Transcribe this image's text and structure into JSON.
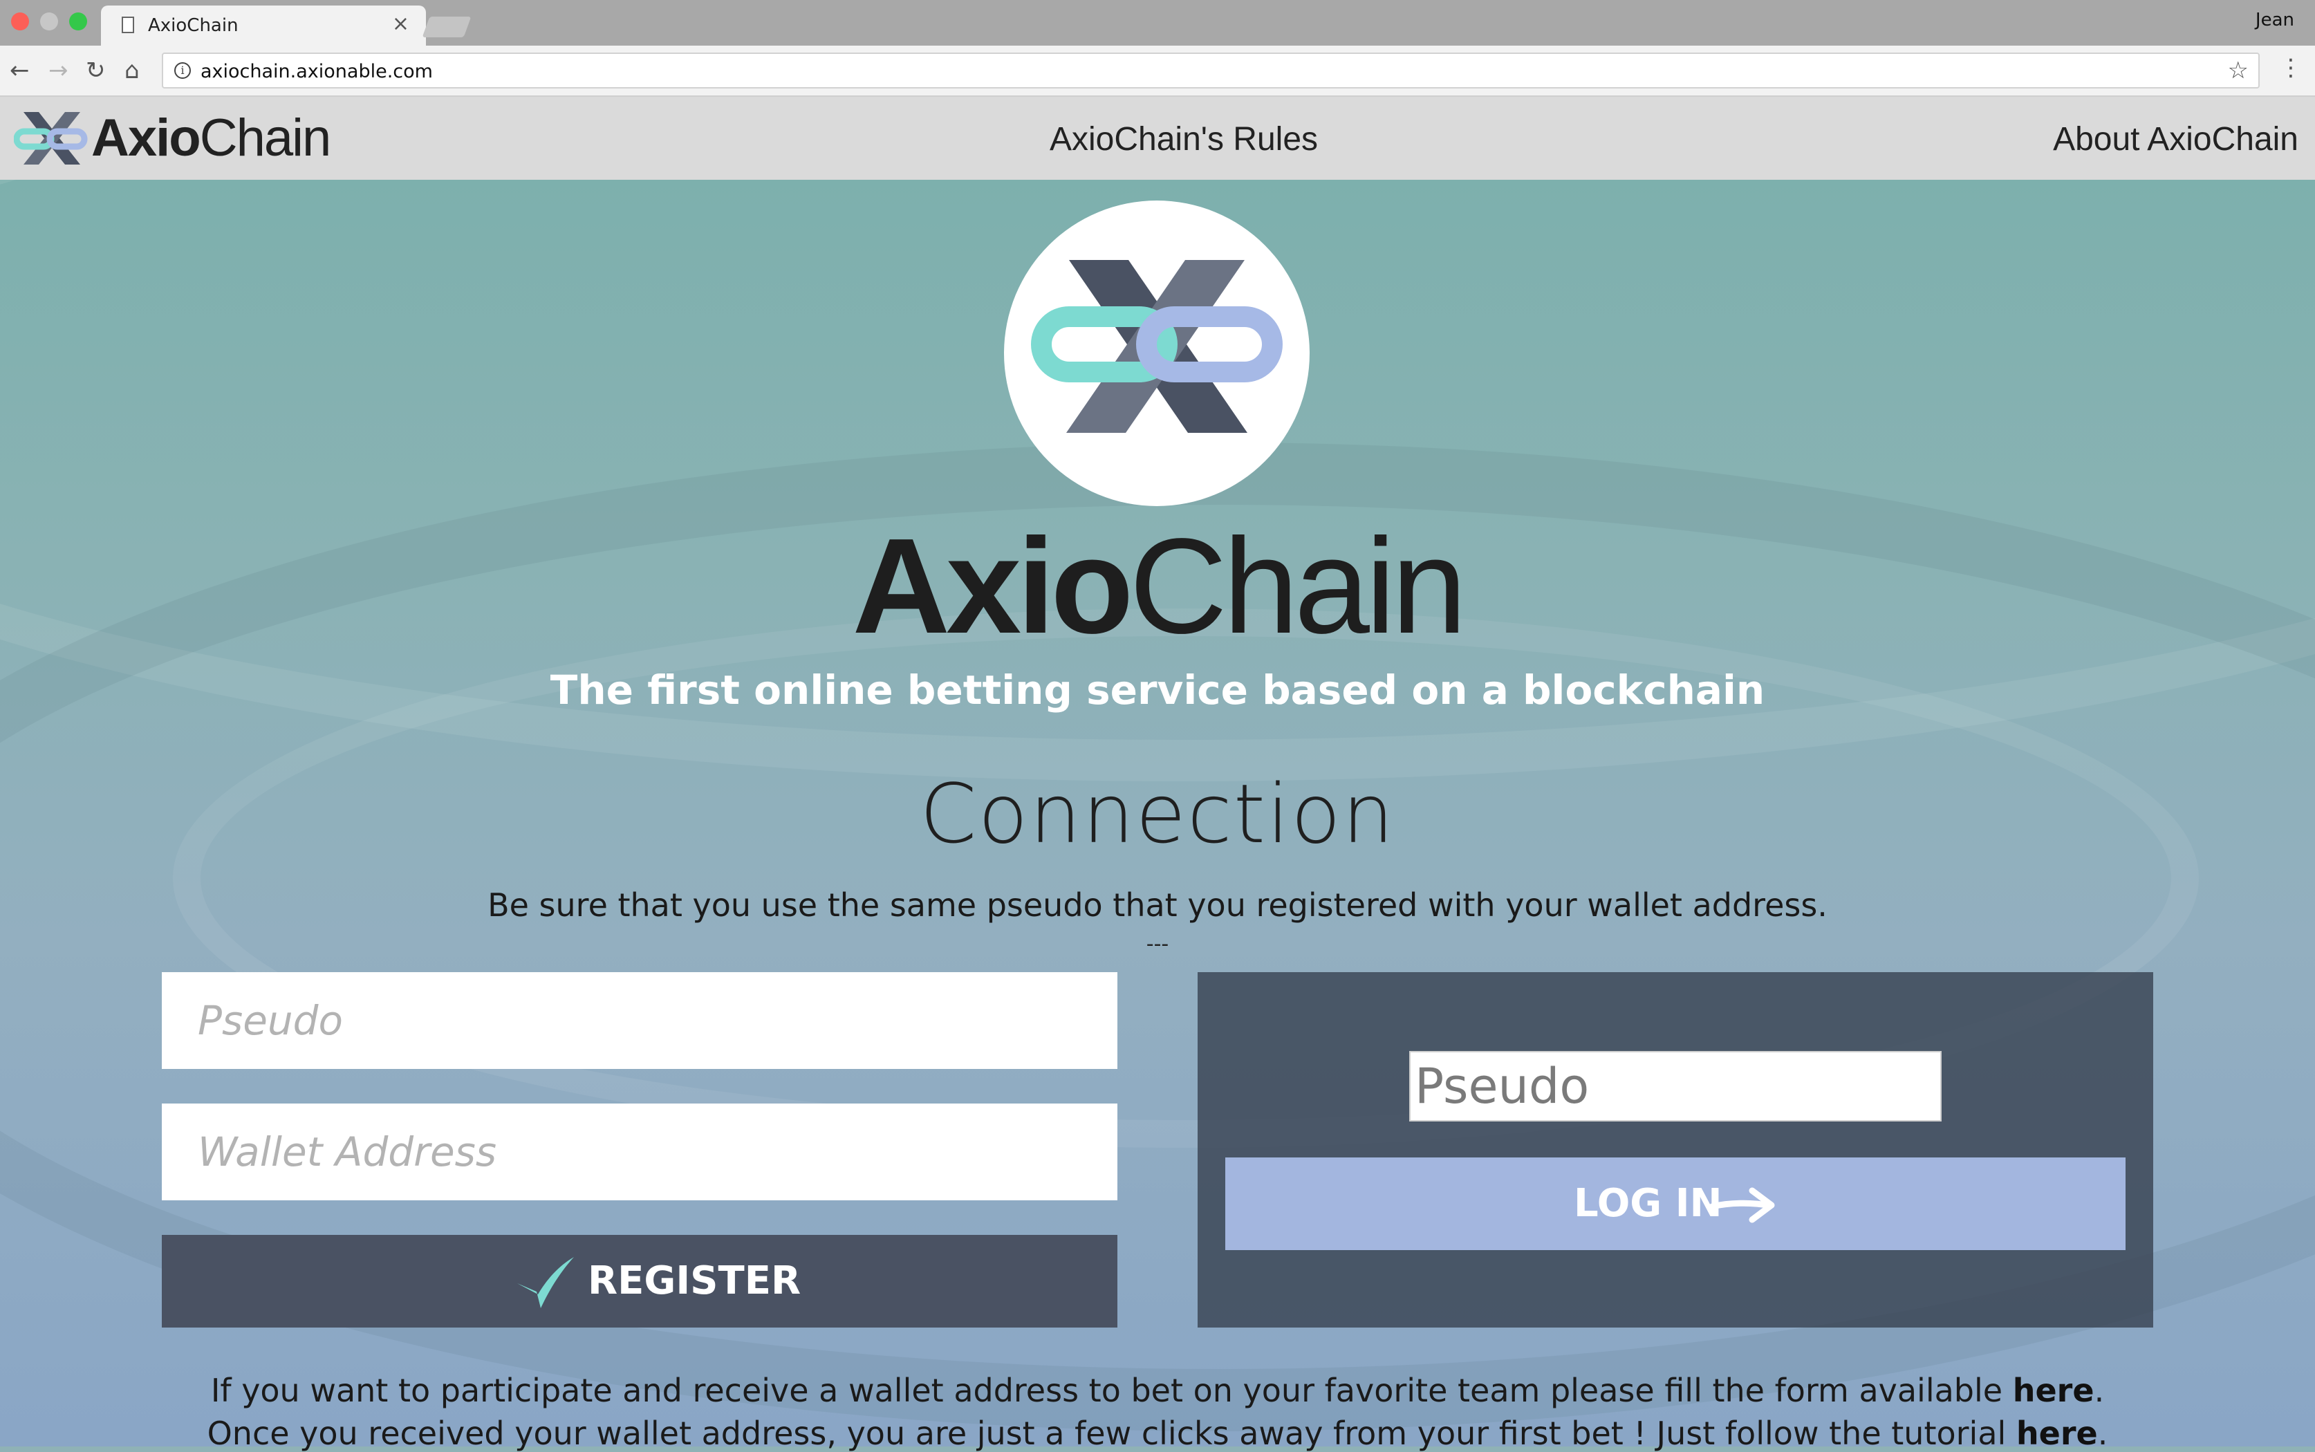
{
  "browser": {
    "tab_title": "AxioChain",
    "tab_close": "×",
    "profile": "Jean",
    "url": "axiochain.axionable.com",
    "icons": {
      "back": "←",
      "forward": "→",
      "reload": "↻",
      "home": "⌂",
      "info": "i",
      "bookmark": "☆",
      "menu": "⋮"
    }
  },
  "header": {
    "brand_bold": "Axio",
    "brand_light": "Chain",
    "nav_rules": "AxioChain's Rules",
    "nav_about": "About AxioChain"
  },
  "hero": {
    "logo_bold": "Axio",
    "logo_light": "Chain",
    "tagline": "The first online betting service based on a blockchain"
  },
  "connection": {
    "title": "Connection",
    "instruction": "Be sure that you use the same pseudo that you registered with your wallet address.",
    "separator": "---"
  },
  "register": {
    "pseudo_placeholder": "Pseudo",
    "wallet_placeholder": "Wallet Address",
    "button_label": "REGISTER"
  },
  "login": {
    "pseudo_placeholder": "Pseudo",
    "button_label": "LOG IN"
  },
  "info": {
    "line1_text": "If you want to participate and receive a wallet address to bet on your favorite team please fill the form available ",
    "line1_link": "here",
    "line1_end": ".",
    "line2_text": "Once you received your wallet address, you are just a few clicks away from your first bet ! Just follow the tutorial ",
    "line2_link": "here",
    "line2_end": "."
  },
  "colors": {
    "teal": "#7ddad1",
    "lavender": "#a6b9e6",
    "slate": "#4a5263",
    "dark_x": "#555d6e"
  }
}
